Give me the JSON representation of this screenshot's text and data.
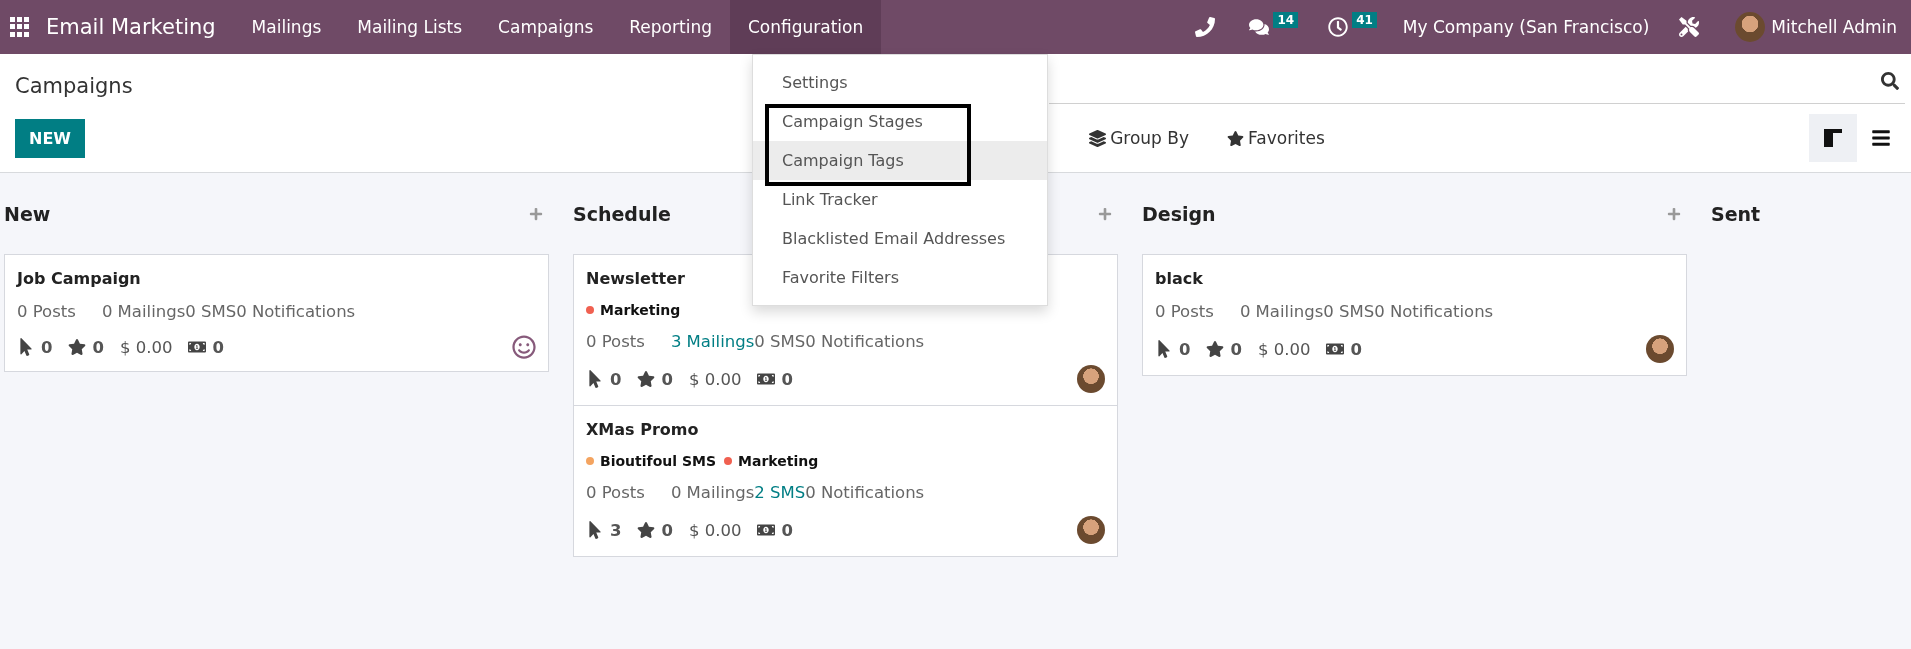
{
  "navbar": {
    "app_name": "Email Marketing",
    "menus": [
      {
        "label": "Mailings",
        "selected": false
      },
      {
        "label": "Mailing Lists",
        "selected": false
      },
      {
        "label": "Campaigns",
        "selected": false
      },
      {
        "label": "Reporting",
        "selected": false
      },
      {
        "label": "Configuration",
        "selected": true
      }
    ],
    "messages_count": "14",
    "activities_count": "41",
    "company": "My Company (San Francisco)",
    "user": "Mitchell Admin"
  },
  "dropdown": {
    "items": [
      {
        "label": "Settings",
        "selected": false
      },
      {
        "label": "Campaign Stages",
        "selected": false
      },
      {
        "label": "Campaign Tags",
        "selected": true
      },
      {
        "label": "Link Tracker",
        "selected": false
      },
      {
        "label": "Blacklisted Email Addresses",
        "selected": false
      },
      {
        "label": "Favorite Filters",
        "selected": false
      }
    ]
  },
  "control_panel": {
    "title": "Campaigns",
    "new_button": "NEW",
    "group_by": "Group By",
    "favorites": "Favorites",
    "views": [
      {
        "kind": "kanban",
        "selected": true
      },
      {
        "kind": "list",
        "selected": false
      }
    ]
  },
  "columns": [
    {
      "name": "New",
      "add_button": true,
      "cards": [
        {
          "title": "Job Campaign",
          "posts": "0 Posts",
          "stats": [
            {
              "text": "0 Mailings",
              "linked": false
            },
            {
              "text": "0 SMS",
              "linked": false
            },
            {
              "text": "0 Notifications",
              "linked": false
            }
          ],
          "clicks": "0",
          "stars": "0",
          "revenue": "$ 0.00",
          "money": "0",
          "avatar": {
            "kind": "smiley"
          }
        }
      ]
    },
    {
      "name": "Schedule",
      "add_button": true,
      "cards": [
        {
          "title": "Newsletter",
          "tags": [
            {
              "label": "Marketing",
              "color": "#f06050"
            }
          ],
          "posts": "0 Posts",
          "stats": [
            {
              "text": "3 Mailings",
              "linked": true
            },
            {
              "text": "0 SMS",
              "linked": false
            },
            {
              "text": "0 Notifications",
              "linked": false
            }
          ],
          "clicks": "0",
          "stars": "0",
          "revenue": "$ 0.00",
          "money": "0",
          "avatar": {
            "kind": "photo"
          }
        },
        {
          "title": "XMas Promo",
          "tags": [
            {
              "label": "Bioutifoul SMS",
              "color": "#f4a460"
            },
            {
              "label": "Marketing",
              "color": "#f06050"
            }
          ],
          "posts": "0 Posts",
          "stats": [
            {
              "text": "0 Mailings",
              "linked": false
            },
            {
              "text": "2 SMS",
              "linked": true
            },
            {
              "text": "0 Notifications",
              "linked": false
            }
          ],
          "clicks": "3",
          "stars": "0",
          "revenue": "$ 0.00",
          "money": "0",
          "avatar": {
            "kind": "photo"
          }
        }
      ]
    },
    {
      "name": "Design",
      "add_button": true,
      "cards": [
        {
          "title": "black",
          "posts": "0 Posts",
          "stats": [
            {
              "text": "0 Mailings",
              "linked": false
            },
            {
              "text": "0 SMS",
              "linked": false
            },
            {
              "text": "0 Notifications",
              "linked": false
            }
          ],
          "clicks": "0",
          "stars": "0",
          "revenue": "$ 0.00",
          "money": "0",
          "avatar": {
            "kind": "photo"
          }
        }
      ]
    },
    {
      "name": "Sent",
      "add_button": false
    }
  ]
}
